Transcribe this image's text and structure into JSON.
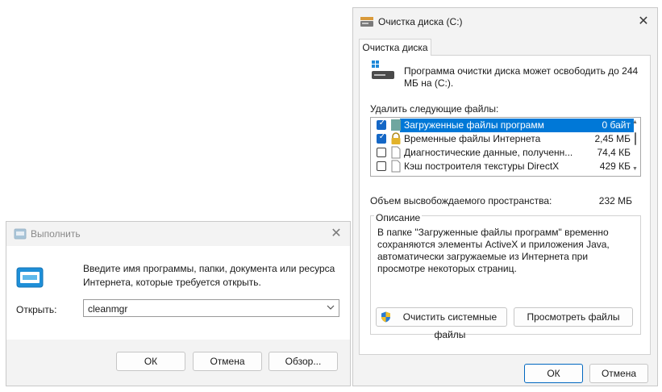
{
  "run_dialog": {
    "title": "Выполнить",
    "description": "Введите имя программы, папки, документа или ресурса Интернета, которые требуется открыть.",
    "open_label": "Открыть:",
    "input_value": "cleanmgr",
    "ok_label": "ОК",
    "cancel_label": "Отмена",
    "browse_label": "Обзор...",
    "icon": "run-icon"
  },
  "disk_cleanup": {
    "title": "Очистка диска  (C:)",
    "tab_label": "Очистка диска",
    "intro": "Программа очистки диска может освободить до 244 МБ на  (C:).",
    "delete_label": "Удалить следующие файлы:",
    "files": [
      {
        "name": "Загруженные файлы программ",
        "size": "0 байт",
        "checked": true,
        "selected": true,
        "icon": "folder-icon"
      },
      {
        "name": "Временные файлы Интернета",
        "size": "2,45 МБ",
        "checked": true,
        "selected": false,
        "icon": "lock-icon"
      },
      {
        "name": "Диагностические данные, полученн...",
        "size": "74,4 КБ",
        "checked": false,
        "selected": false,
        "icon": "file-icon"
      },
      {
        "name": "Кэш построителя текстуры DirectX",
        "size": "429 КБ",
        "checked": false,
        "selected": false,
        "icon": "file-icon"
      }
    ],
    "space_label": "Объем высвобождаемого пространства:",
    "space_value": "232 МБ",
    "description_title": "Описание",
    "description_text": "В папке \"Загруженные файлы программ\" временно сохраняются элементы ActiveX и приложения Java, автоматически загружаемые из Интернета при просмотре некоторых страниц.",
    "system_files_button": "Очистить системные файлы",
    "view_files_button": "Просмотреть файлы",
    "ok_label": "ОК",
    "cancel_label": "Отмена",
    "colors": {
      "selection": "#0078d7",
      "checkbox": "#1467c6",
      "primary_border": "#0067c0"
    }
  }
}
